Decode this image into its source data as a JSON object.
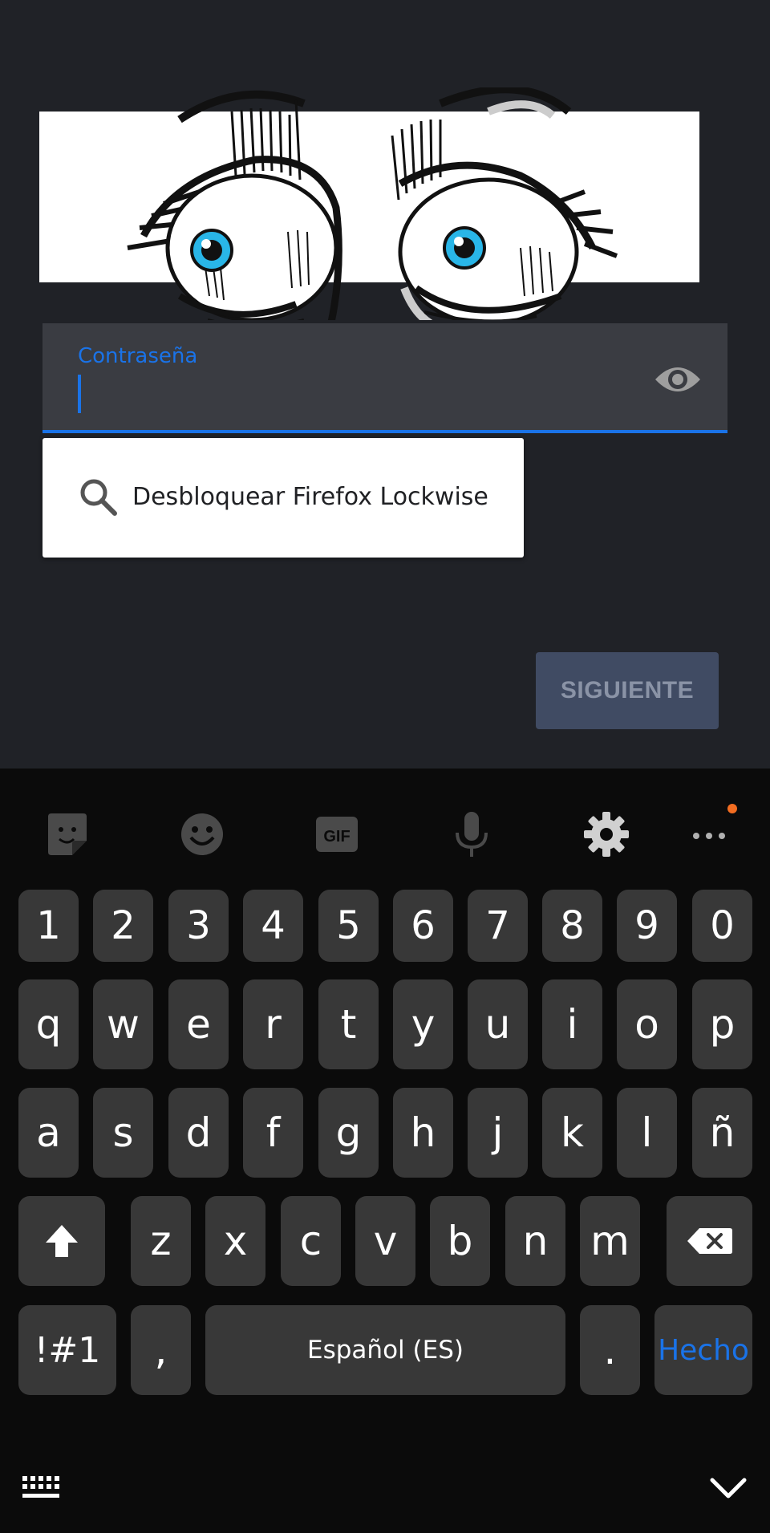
{
  "password_field": {
    "label": "Contraseña",
    "value": ""
  },
  "suggestion": {
    "text": "Desbloquear Firefox Lockwise"
  },
  "next_button": {
    "label": "SIGUIENTE"
  },
  "colors": {
    "accent": "#1a73e8",
    "background": "#202227",
    "field_bg": "#3a3c42",
    "button_disabled": "#404b63",
    "keyboard_bg": "#0b0b0b",
    "key_bg": "#383838",
    "notification_dot": "#f36d21"
  },
  "keyboard": {
    "toolbar": [
      "sticker-icon",
      "emoji-icon",
      "gif-icon",
      "microphone-icon",
      "settings-gear-icon",
      "more-options-icon"
    ],
    "gif_label": "GIF",
    "digits": [
      "1",
      "2",
      "3",
      "4",
      "5",
      "6",
      "7",
      "8",
      "9",
      "0"
    ],
    "row1": [
      "q",
      "w",
      "e",
      "r",
      "t",
      "y",
      "u",
      "i",
      "o",
      "p"
    ],
    "row2": [
      "a",
      "s",
      "d",
      "f",
      "g",
      "h",
      "j",
      "k",
      "l",
      "ñ"
    ],
    "row3": [
      "z",
      "x",
      "c",
      "v",
      "b",
      "n",
      "m"
    ],
    "symbols_label": "!#1",
    "comma_label": ",",
    "space_label": "Español (ES)",
    "period_label": ".",
    "done_label": "Hecho"
  },
  "navbar": [
    "keyboard-switch-icon",
    "hide-keyboard-chevron-icon"
  ]
}
